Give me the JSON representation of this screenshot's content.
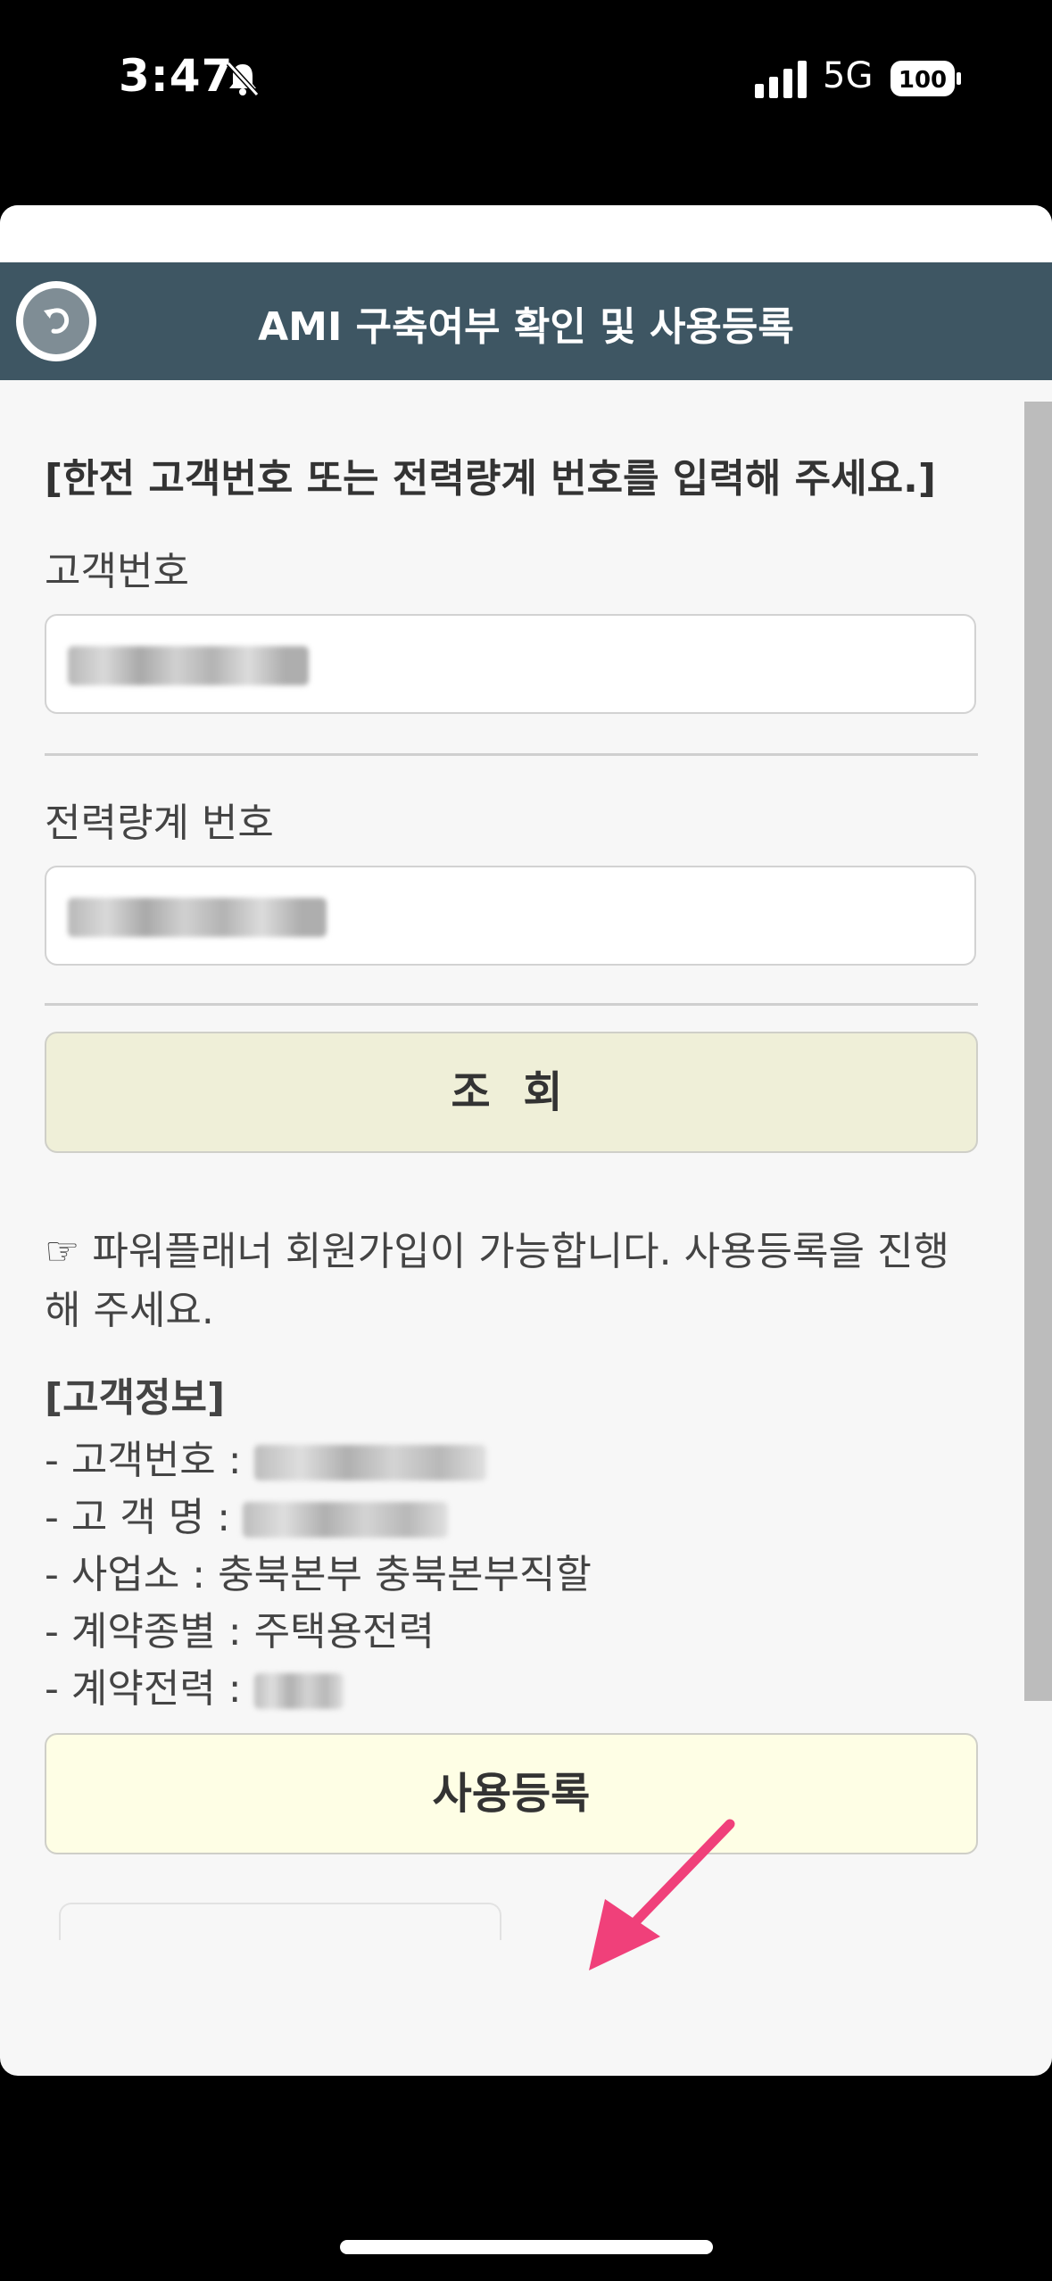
{
  "status_bar": {
    "time": "3:47",
    "network": "5G",
    "battery": "100"
  },
  "header": {
    "title": "AMI 구축여부 확인 및 사용등록"
  },
  "instruction": "[한전 고객번호 또는 전력량계 번호를 입력해 주세요.]",
  "form": {
    "customer_number_label": "고객번호",
    "meter_number_label": "전력량계 번호",
    "search_button": "조 회"
  },
  "notice": "☞ 파워플래너 회원가입이 가능합니다. 사용등록을 진행해 주세요.",
  "customer_info": {
    "title": "[고객정보]",
    "customer_number_label": "- 고객번호 : ",
    "customer_name_label": "- 고 객 명 : ",
    "office": "- 사업소 : 충북본부 충북본부직할",
    "contract_type": "- 계약종별 : 주택용전력",
    "contract_power_label": "- 계약전력 : "
  },
  "register_button": "사용등록",
  "colors": {
    "header_bg": "#3e5663",
    "search_btn_bg": "#efefd8",
    "register_btn_bg": "#fefee5",
    "arrow": "#f0407a"
  }
}
